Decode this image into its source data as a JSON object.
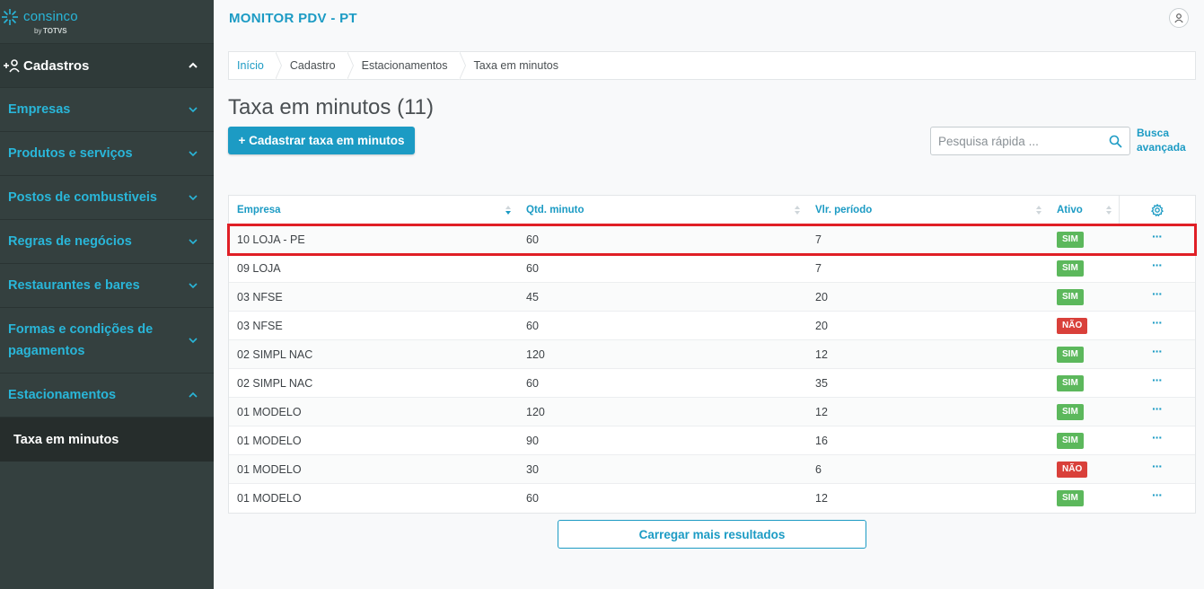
{
  "sidebar": {
    "logo": {
      "brand": "consinco",
      "by": "by",
      "totvs": "TOTVS"
    },
    "section": {
      "label": "Cadastros"
    },
    "items": [
      {
        "label": "Empresas"
      },
      {
        "label": "Produtos e serviços"
      },
      {
        "label": "Postos de combustiveis"
      },
      {
        "label": "Regras de negócios"
      },
      {
        "label": "Restaurantes e bares"
      },
      {
        "label": "Formas e condições de pagamentos"
      },
      {
        "label": "Estacionamentos"
      }
    ],
    "sub_item": {
      "label": "Taxa em minutos"
    }
  },
  "header": {
    "app_title": "MONITOR PDV - PT"
  },
  "breadcrumb": [
    "Início",
    "Cadastro",
    "Estacionamentos",
    "Taxa em minutos"
  ],
  "page": {
    "title": "Taxa em minutos (11)",
    "add_button": "+ Cadastrar taxa em minutos",
    "search_placeholder": "Pesquisa rápida ...",
    "advanced_search": "Busca avançada",
    "load_more": "Carregar mais resultados"
  },
  "table": {
    "columns": [
      "Empresa",
      "Qtd. minuto",
      "Vlr. período",
      "Ativo"
    ],
    "rows": [
      {
        "empresa": "10 LOJA - PE",
        "qtd": "60",
        "vlr": "7",
        "ativo": "SIM"
      },
      {
        "empresa": "09 LOJA",
        "qtd": "60",
        "vlr": "7",
        "ativo": "SIM"
      },
      {
        "empresa": "03 NFSE",
        "qtd": "45",
        "vlr": "20",
        "ativo": "SIM"
      },
      {
        "empresa": "03 NFSE",
        "qtd": "60",
        "vlr": "20",
        "ativo": "NÃO"
      },
      {
        "empresa": "02 SIMPL NAC",
        "qtd": "120",
        "vlr": "12",
        "ativo": "SIM"
      },
      {
        "empresa": "02 SIMPL NAC",
        "qtd": "60",
        "vlr": "35",
        "ativo": "SIM"
      },
      {
        "empresa": "01 MODELO",
        "qtd": "120",
        "vlr": "12",
        "ativo": "SIM"
      },
      {
        "empresa": "01 MODELO",
        "qtd": "90",
        "vlr": "16",
        "ativo": "SIM"
      },
      {
        "empresa": "01 MODELO",
        "qtd": "30",
        "vlr": "6",
        "ativo": "NÃO"
      },
      {
        "empresa": "01 MODELO",
        "qtd": "60",
        "vlr": "12",
        "ativo": "SIM"
      }
    ],
    "row_action": "···"
  },
  "colors": {
    "accent": "#1c9bc4",
    "sidebar_bg": "#34403f",
    "sim": "#5cb85c",
    "nao": "#d9403a",
    "highlight": "#e01f26"
  }
}
